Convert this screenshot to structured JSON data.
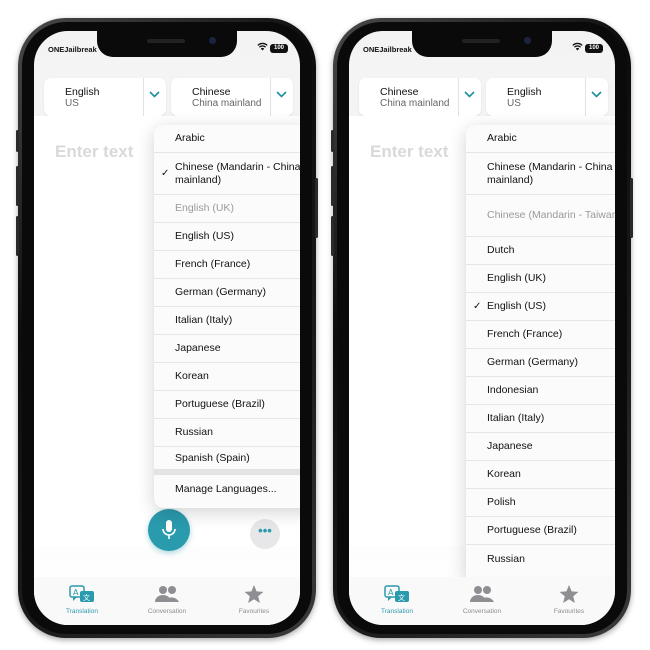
{
  "status": {
    "carrier": "ONEJailbreak",
    "battery": "100"
  },
  "input_placeholder": "Enter text",
  "more_label": "•••",
  "left_screen": {
    "source": {
      "name": "English",
      "region": "US"
    },
    "target": {
      "name": "Chinese",
      "region": "China mainland"
    },
    "menu": [
      {
        "label": "Arabic"
      },
      {
        "label": "Chinese (Mandarin - China mainland)",
        "checked": true
      },
      {
        "label": "English (UK)",
        "dim": true
      },
      {
        "label": "English (US)"
      },
      {
        "label": "French (France)"
      },
      {
        "label": "German (Germany)"
      },
      {
        "label": "Italian (Italy)"
      },
      {
        "label": "Japanese"
      },
      {
        "label": "Korean"
      },
      {
        "label": "Portuguese (Brazil)"
      },
      {
        "label": "Russian"
      },
      {
        "label": "Spanish (Spain)"
      },
      {
        "label": "Manage Languages..."
      }
    ]
  },
  "right_screen": {
    "source": {
      "name": "Chinese",
      "region": "China mainland"
    },
    "target": {
      "name": "English",
      "region": "US"
    },
    "menu": [
      {
        "label": "Arabic"
      },
      {
        "label": "Chinese (Mandarin - China mainland)"
      },
      {
        "label": "Chinese (Mandarin - Taiwan)",
        "dim": true
      },
      {
        "label": "Dutch"
      },
      {
        "label": "English (UK)"
      },
      {
        "label": "English (US)",
        "checked": true
      },
      {
        "label": "French (France)"
      },
      {
        "label": "German (Germany)"
      },
      {
        "label": "Indonesian"
      },
      {
        "label": "Italian (Italy)"
      },
      {
        "label": "Japanese"
      },
      {
        "label": "Korean"
      },
      {
        "label": "Polish"
      },
      {
        "label": "Portuguese (Brazil)"
      },
      {
        "label": "Russian"
      }
    ]
  },
  "tabs": [
    {
      "label": "Translation",
      "icon": "translation-icon",
      "active": true
    },
    {
      "label": "Conversation",
      "icon": "conversation-icon"
    },
    {
      "label": "Favourites",
      "icon": "star-icon"
    }
  ],
  "colors": {
    "accent": "#2a9aad",
    "dim_text": "#9a9a9a",
    "placeholder": "#d9d9d9"
  }
}
